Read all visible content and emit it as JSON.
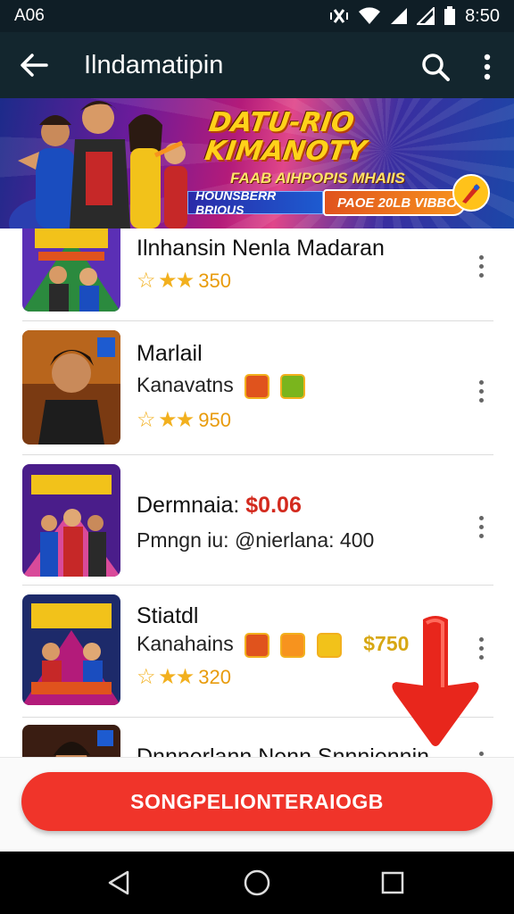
{
  "status_bar": {
    "left_text": "A06",
    "time": "8:50"
  },
  "toolbar": {
    "title": "Ilndamatipin"
  },
  "banner": {
    "headline": "DATU-RIO KIMANOTY",
    "subtitle": "FAAB AIHPOPIS MHAIIS",
    "strip_text": "HOUNSBERR BRIOUS",
    "price_text": "PAOE 20LB VIBBO"
  },
  "items": [
    {
      "title": "Ilnhansin Nenla Madaran",
      "rating": "350"
    },
    {
      "title": "Marlail",
      "subtitle": "Kanavatns",
      "rating": "950"
    },
    {
      "title": "Dermnaia:",
      "price": "$0.06",
      "subtitle": "Pmngn iu: @nierlana: 400"
    },
    {
      "title": "Stiatdl",
      "subtitle": "Kanahains",
      "price": "$750",
      "rating": "320"
    },
    {
      "title": "Dnnnerlann Nenn Snnniennin"
    }
  ],
  "cta": {
    "label": "SONGPELIONTERAIOGB"
  },
  "colors": {
    "toolbar_bg": "#13262e",
    "cta_red": "#f0342a",
    "price_red": "#d32a1e",
    "star_gold": "#f2b01e"
  }
}
